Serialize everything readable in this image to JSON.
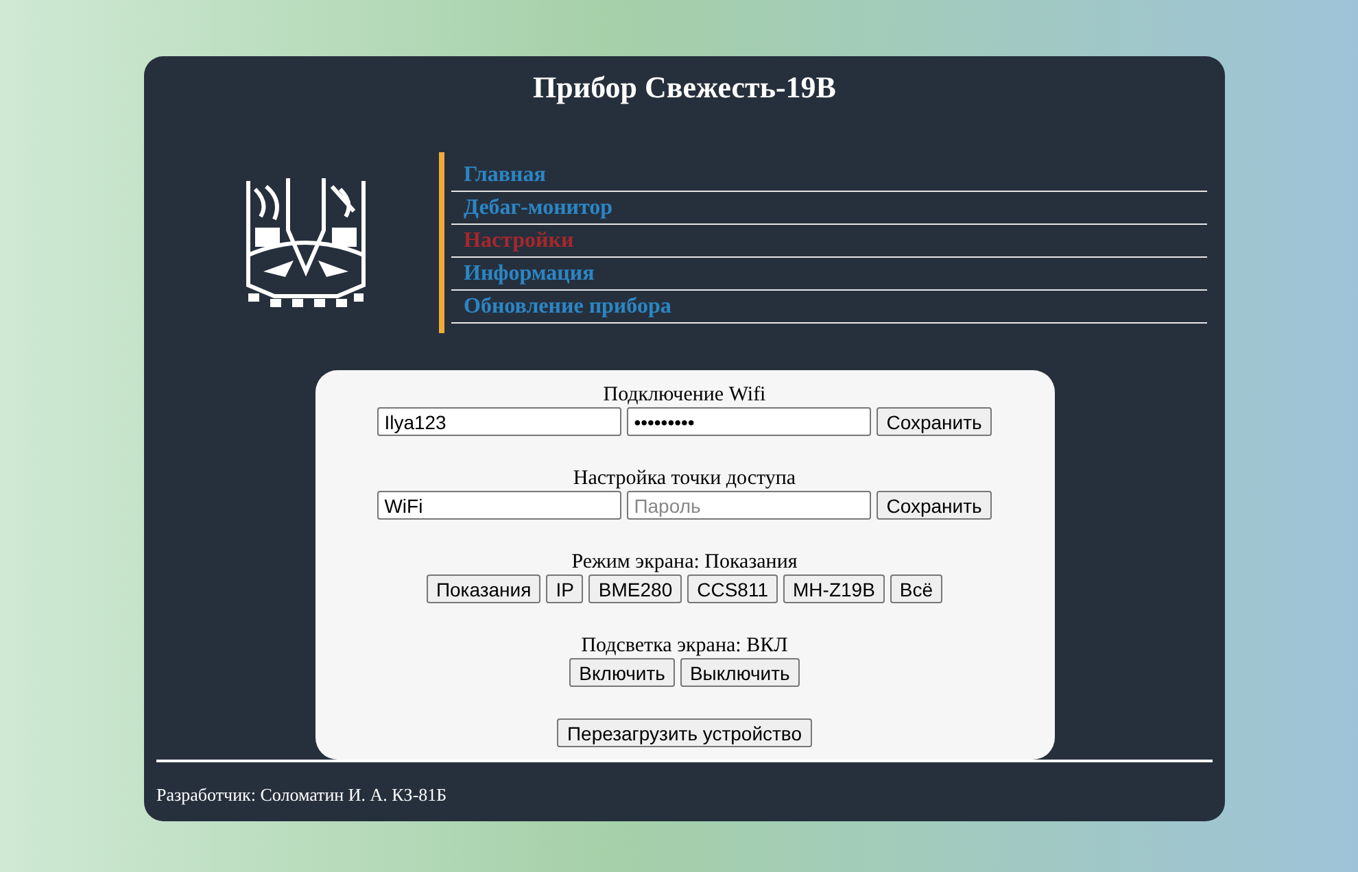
{
  "title": "Прибор Свежесть-19В",
  "nav": [
    {
      "label": "Главная",
      "selected": false
    },
    {
      "label": "Дебаг-монитор",
      "selected": false
    },
    {
      "label": "Настройки",
      "selected": true
    },
    {
      "label": "Информация",
      "selected": false
    },
    {
      "label": "Обновление прибора",
      "selected": false
    }
  ],
  "sections": [
    {
      "kind": "credentials",
      "heading": "Подключение Wifi",
      "login": {
        "value": "Ilya123"
      },
      "password": {
        "value": "•••••••••"
      },
      "buttons": [
        "Сохранить"
      ]
    },
    {
      "kind": "credentials",
      "heading": "Настройка точки доступа",
      "login": {
        "value": "WiFi"
      },
      "password": {
        "placeholder": "Пароль"
      },
      "buttons": [
        "Сохранить"
      ]
    },
    {
      "kind": "buttons",
      "heading": "Режим экрана: Показания",
      "buttons": [
        "Показания",
        "IP",
        "BME280",
        "CCS811",
        "MH-Z19B",
        "Всё"
      ]
    },
    {
      "kind": "buttons",
      "heading": "Подсветка экрана: ВКЛ",
      "buttons": [
        "Включить",
        "Выключить"
      ]
    },
    {
      "kind": "buttons",
      "buttons": [
        "Перезагрузить устройство"
      ]
    }
  ],
  "footer": "Разработчик: Соломатин И. А. КЗ-81Б"
}
